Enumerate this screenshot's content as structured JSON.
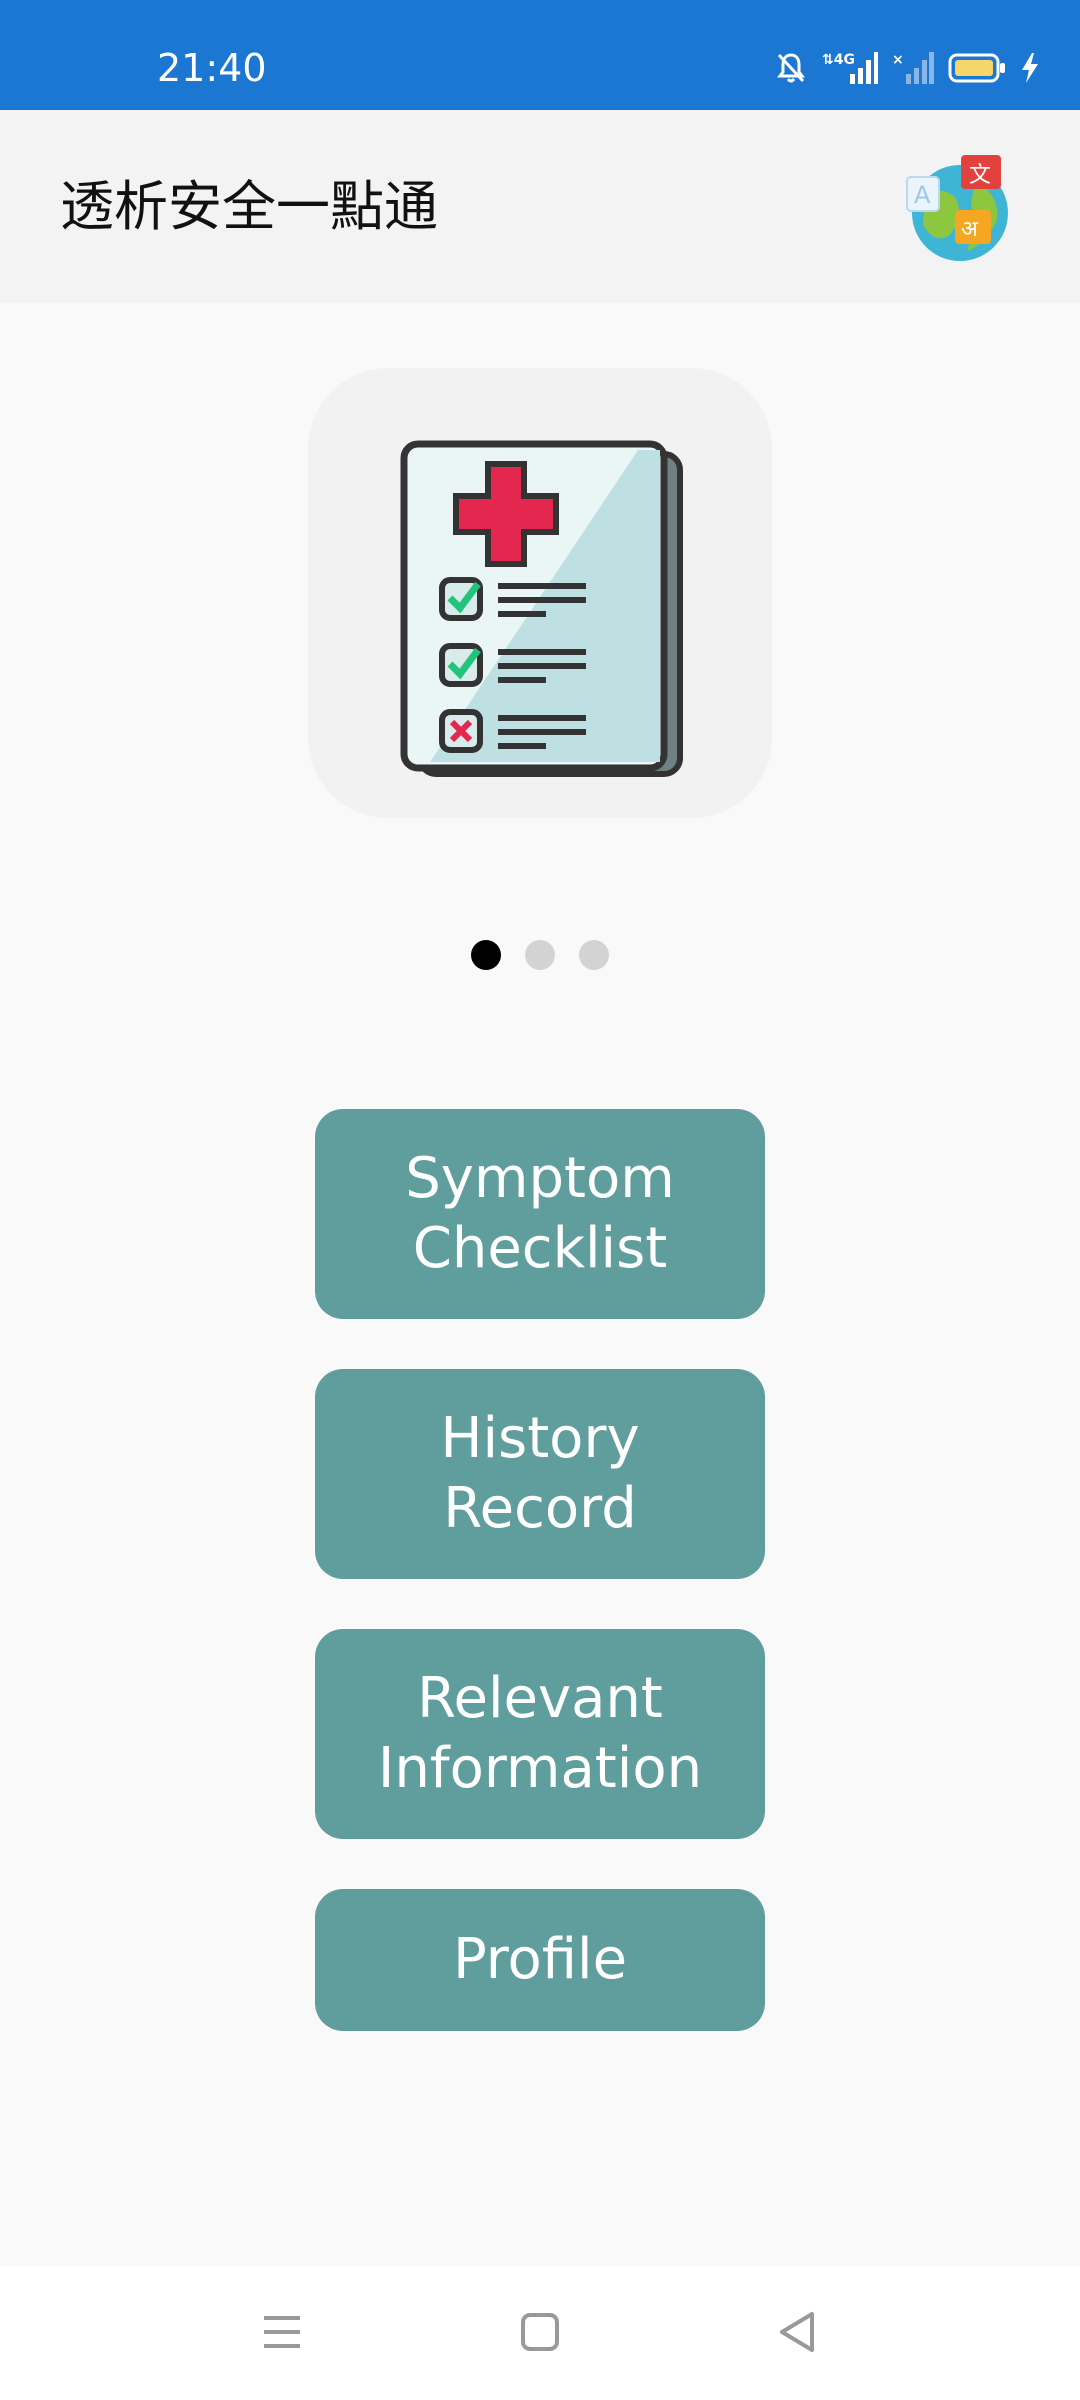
{
  "status_bar": {
    "time": "21:40",
    "icons": [
      "bell-muted-icon",
      "4g-signal-icon",
      "no-signal-icon",
      "battery-icon",
      "charging-icon"
    ],
    "background_color": "#1b77d2"
  },
  "app_bar": {
    "title": "透析安全一點通",
    "translate_icon": "translate-globe-icon"
  },
  "carousel": {
    "image_icon": "medical-checklist-icon",
    "page_count": 3,
    "active_index": 0
  },
  "menu": {
    "button_color": "#609e9e",
    "symptom_checklist": "Symptom\nChecklist",
    "history_record": "History\nRecord",
    "relevant_information": "Relevant\nInformation",
    "profile": "Profile"
  },
  "nav_bar": {
    "icons": [
      "menu-lines-icon",
      "home-square-icon",
      "back-triangle-icon"
    ]
  }
}
